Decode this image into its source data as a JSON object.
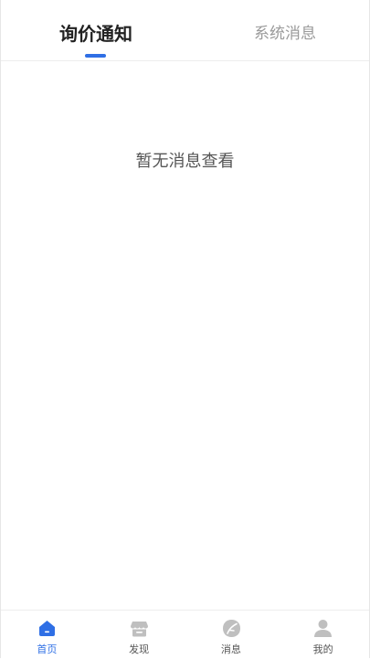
{
  "tabs": [
    {
      "label": "询价通知",
      "active": true
    },
    {
      "label": "系统消息",
      "active": false
    }
  ],
  "empty_state": {
    "text": "暂无消息查看"
  },
  "bottom_nav": [
    {
      "label": "首页",
      "icon": "home-icon",
      "active": true
    },
    {
      "label": "发现",
      "icon": "store-icon",
      "active": false
    },
    {
      "label": "消息",
      "icon": "leaf-icon",
      "active": false
    },
    {
      "label": "我的",
      "icon": "user-icon",
      "active": false
    }
  ],
  "colors": {
    "accent": "#2f6fe5",
    "inactive_icon": "#bfbfbf",
    "tab_inactive_text": "#9a9a9a",
    "text_primary": "#222222",
    "text_secondary": "#555555"
  }
}
